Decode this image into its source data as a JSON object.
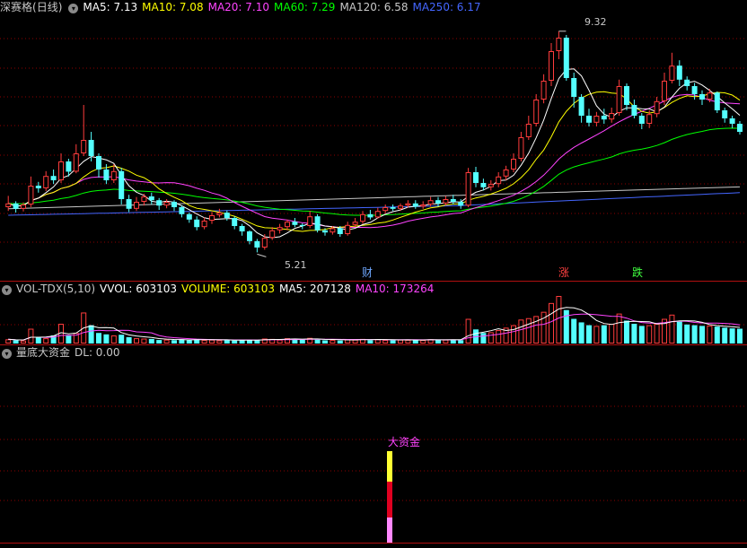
{
  "price_header": {
    "stock_name": "深赛格",
    "period": "(日线)",
    "ma_labels": [
      {
        "text": "MA5: 7.13",
        "color": "#ffffff"
      },
      {
        "text": "MA10: 7.08",
        "color": "#ffff00"
      },
      {
        "text": "MA20: 7.10",
        "color": "#ff44ff"
      },
      {
        "text": "MA60: 7.29",
        "color": "#00ff00"
      },
      {
        "text": "MA120: 6.58",
        "color": "#c8c8c8"
      },
      {
        "text": "MA250: 6.17",
        "color": "#4466ff"
      }
    ]
  },
  "volume_header": {
    "labels": [
      {
        "text": "VOL-TDX(5,10)",
        "color": "#c8c8c8"
      },
      {
        "text": "VVOL: 603103",
        "color": "#ffffff"
      },
      {
        "text": "VOLUME: 603103",
        "color": "#ffff00"
      },
      {
        "text": "MA5: 207128",
        "color": "#ffffff"
      },
      {
        "text": "MA10: 173264",
        "color": "#ff44ff"
      }
    ]
  },
  "indicator_header": {
    "labels": [
      {
        "text": "量底大资金",
        "color": "#c8c8c8"
      },
      {
        "text": "DL: 0.00",
        "color": "#c8c8c8"
      }
    ]
  },
  "annotations": {
    "high_label": "9.32",
    "low_label": "5.21",
    "signal_cai": "财",
    "signal_zhang": "涨",
    "signal_die": "跌",
    "indicator_signal": "大资金"
  },
  "colors": {
    "up": "#ff3c3c",
    "down": "#54ffff",
    "grid": "#8b0000",
    "divider": "#b01010"
  },
  "chart_data": [
    {
      "type": "candlestick",
      "title": "深赛格 (日线)",
      "y_range": [
        4.9,
        9.6
      ],
      "series": [
        {
          "name": "MA5",
          "value": 7.13,
          "color": "#ffffff"
        },
        {
          "name": "MA10",
          "value": 7.08,
          "color": "#ffff00"
        },
        {
          "name": "MA20",
          "value": 7.1,
          "color": "#ff44ff"
        },
        {
          "name": "MA60",
          "value": 7.29,
          "color": "#00ff00"
        },
        {
          "name": "MA120",
          "value": 6.58,
          "color": "#c8c8c8"
        },
        {
          "name": "MA250",
          "value": 6.17,
          "color": "#4466ff"
        }
      ],
      "high": 9.32,
      "low": 5.21,
      "candles": [
        [
          6.05,
          6.12,
          6.26,
          5.98
        ],
        [
          6.12,
          6.02,
          6.16,
          5.95
        ],
        [
          6.02,
          6.1,
          6.14,
          5.97
        ],
        [
          6.1,
          6.45,
          6.62,
          6.05
        ],
        [
          6.45,
          6.4,
          6.52,
          6.32
        ],
        [
          6.4,
          6.63,
          6.72,
          6.35
        ],
        [
          6.63,
          6.55,
          6.75,
          6.48
        ],
        [
          6.55,
          6.9,
          7.05,
          6.5
        ],
        [
          6.9,
          6.71,
          6.95,
          6.62
        ],
        [
          6.71,
          7.05,
          7.22,
          6.68
        ],
        [
          7.05,
          7.3,
          7.95,
          7.0
        ],
        [
          7.3,
          7.0,
          7.45,
          6.9
        ],
        [
          7.0,
          6.75,
          7.05,
          6.6
        ],
        [
          6.75,
          6.55,
          6.85,
          6.48
        ],
        [
          6.55,
          6.72,
          6.85,
          6.5
        ],
        [
          6.72,
          6.2,
          6.78,
          6.1
        ],
        [
          6.2,
          6.02,
          6.28,
          5.96
        ],
        [
          6.02,
          6.15,
          6.24,
          5.98
        ],
        [
          6.15,
          6.25,
          6.3,
          6.08
        ],
        [
          6.25,
          6.18,
          6.32,
          6.1
        ],
        [
          6.18,
          6.08,
          6.22,
          6.0
        ],
        [
          6.08,
          6.15,
          6.2,
          6.03
        ],
        [
          6.15,
          6.05,
          6.18,
          5.98
        ],
        [
          6.05,
          5.92,
          6.08,
          5.86
        ],
        [
          5.92,
          5.82,
          5.95,
          5.76
        ],
        [
          5.82,
          5.68,
          5.88,
          5.62
        ],
        [
          5.68,
          5.8,
          5.86,
          5.64
        ],
        [
          5.8,
          5.9,
          5.96,
          5.74
        ],
        [
          5.9,
          5.95,
          6.02,
          5.86
        ],
        [
          5.95,
          5.85,
          5.99,
          5.8
        ],
        [
          5.85,
          5.7,
          5.88,
          5.64
        ],
        [
          5.7,
          5.6,
          5.74,
          5.52
        ],
        [
          5.6,
          5.42,
          5.62,
          5.36
        ],
        [
          5.42,
          5.3,
          5.46,
          5.21
        ],
        [
          5.3,
          5.48,
          5.55,
          5.26
        ],
        [
          5.48,
          5.62,
          5.68,
          5.44
        ],
        [
          5.62,
          5.68,
          5.74,
          5.56
        ],
        [
          5.68,
          5.78,
          5.82,
          5.62
        ],
        [
          5.78,
          5.72,
          5.85,
          5.68
        ],
        [
          5.72,
          5.7,
          5.75,
          5.64
        ],
        [
          5.7,
          5.88,
          5.98,
          5.66
        ],
        [
          5.88,
          5.62,
          5.92,
          5.58
        ],
        [
          5.62,
          5.58,
          5.66,
          5.52
        ],
        [
          5.58,
          5.66,
          5.7,
          5.54
        ],
        [
          5.66,
          5.55,
          5.7,
          5.5
        ],
        [
          5.55,
          5.72,
          5.78,
          5.52
        ],
        [
          5.72,
          5.78,
          5.85,
          5.68
        ],
        [
          5.78,
          5.92,
          5.98,
          5.74
        ],
        [
          5.92,
          5.86,
          6.0,
          5.82
        ],
        [
          5.86,
          5.98,
          6.04,
          5.84
        ],
        [
          5.98,
          6.05,
          6.1,
          5.94
        ],
        [
          6.05,
          6.02,
          6.1,
          5.98
        ],
        [
          6.02,
          6.08,
          6.12,
          5.98
        ],
        [
          6.08,
          6.12,
          6.18,
          6.04
        ],
        [
          6.12,
          6.06,
          6.18,
          6.02
        ],
        [
          6.06,
          6.1,
          6.16,
          6.02
        ],
        [
          6.1,
          6.18,
          6.24,
          6.06
        ],
        [
          6.18,
          6.12,
          6.24,
          6.06
        ],
        [
          6.12,
          6.2,
          6.26,
          6.08
        ],
        [
          6.2,
          6.15,
          6.28,
          6.1
        ],
        [
          6.15,
          6.08,
          6.2,
          6.02
        ],
        [
          6.08,
          6.7,
          6.78,
          6.05
        ],
        [
          6.7,
          6.5,
          6.8,
          6.42
        ],
        [
          6.5,
          6.42,
          6.58,
          6.36
        ],
        [
          6.42,
          6.48,
          6.55,
          6.36
        ],
        [
          6.48,
          6.62,
          6.7,
          6.42
        ],
        [
          6.62,
          6.75,
          6.82,
          6.55
        ],
        [
          6.75,
          6.95,
          7.05,
          6.7
        ],
        [
          6.95,
          7.35,
          7.45,
          6.9
        ],
        [
          7.35,
          7.6,
          7.75,
          7.3
        ],
        [
          7.6,
          8.05,
          8.15,
          7.55
        ],
        [
          8.05,
          8.4,
          8.52,
          7.98
        ],
        [
          8.4,
          8.95,
          9.1,
          8.3
        ],
        [
          8.95,
          9.2,
          9.32,
          8.8
        ],
        [
          9.2,
          8.45,
          9.25,
          8.4
        ],
        [
          8.45,
          8.1,
          8.55,
          7.9
        ],
        [
          8.1,
          7.75,
          8.15,
          7.62
        ],
        [
          7.75,
          7.62,
          7.88,
          7.55
        ],
        [
          7.62,
          7.75,
          7.82,
          7.55
        ],
        [
          7.75,
          7.68,
          7.88,
          7.6
        ],
        [
          7.68,
          7.8,
          7.9,
          7.62
        ],
        [
          7.8,
          8.3,
          8.42,
          7.75
        ],
        [
          8.3,
          7.95,
          8.35,
          7.85
        ],
        [
          7.95,
          7.75,
          8.05,
          7.7
        ],
        [
          7.75,
          7.6,
          7.8,
          7.5
        ],
        [
          7.6,
          7.78,
          7.85,
          7.52
        ],
        [
          7.78,
          8.02,
          8.1,
          7.72
        ],
        [
          8.02,
          8.4,
          8.55,
          7.95
        ],
        [
          8.4,
          8.68,
          8.92,
          8.35
        ],
        [
          8.68,
          8.42,
          8.78,
          8.3
        ],
        [
          8.42,
          8.3,
          8.48,
          8.22
        ],
        [
          8.3,
          8.15,
          8.36,
          8.05
        ],
        [
          8.15,
          8.05,
          8.22,
          7.95
        ],
        [
          8.05,
          8.18,
          8.25,
          8.0
        ],
        [
          8.18,
          7.85,
          8.2,
          7.8
        ],
        [
          7.85,
          7.7,
          7.9,
          7.62
        ],
        [
          7.7,
          7.6,
          7.75,
          7.52
        ],
        [
          7.6,
          7.45,
          7.65,
          7.4
        ]
      ]
    },
    {
      "type": "bar",
      "title": "VOL-TDX(5,10)",
      "series": [
        {
          "name": "VVOL",
          "value": 603103
        },
        {
          "name": "VOLUME",
          "value": 603103
        },
        {
          "name": "MA5",
          "value": 207128
        },
        {
          "name": "MA10",
          "value": 173264
        }
      ],
      "volumes": [
        120,
        90,
        85,
        420,
        180,
        150,
        230,
        560,
        240,
        300,
        880,
        520,
        300,
        260,
        230,
        250,
        180,
        150,
        140,
        130,
        100,
        110,
        95,
        120,
        90,
        130,
        100,
        110,
        90,
        95,
        85,
        110,
        90,
        100,
        140,
        130,
        110,
        150,
        120,
        110,
        160,
        110,
        90,
        100,
        85,
        120,
        110,
        130,
        95,
        120,
        100,
        90,
        110,
        105,
        95,
        100,
        120,
        100,
        110,
        105,
        95,
        700,
        400,
        300,
        320,
        380,
        450,
        520,
        680,
        720,
        780,
        900,
        1150,
        1350,
        950,
        700,
        600,
        520,
        500,
        520,
        560,
        850,
        650,
        560,
        500,
        520,
        560,
        700,
        820,
        620,
        540,
        520,
        500,
        510,
        480,
        450,
        430,
        420
      ]
    },
    {
      "type": "bar",
      "title": "量底大资金",
      "series": [
        {
          "name": "DL",
          "value": 0.0
        }
      ]
    }
  ]
}
